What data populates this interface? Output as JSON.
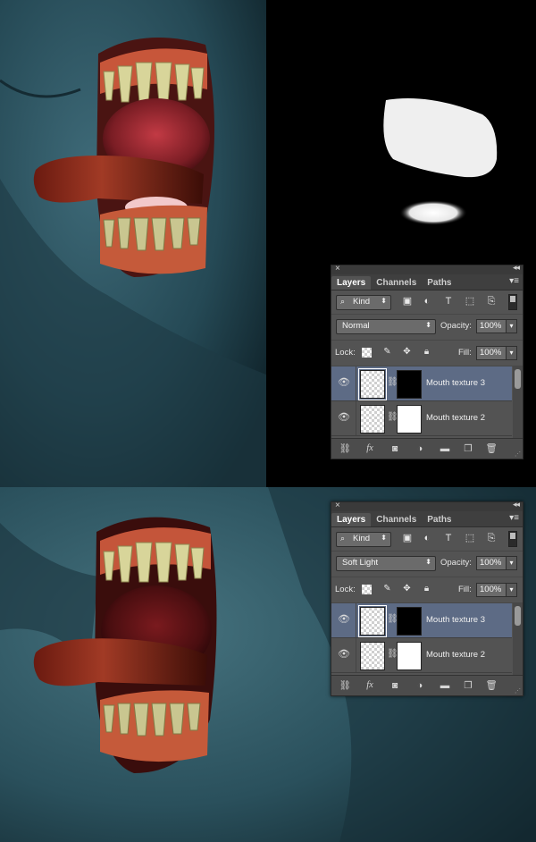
{
  "panels": [
    {
      "id": "top",
      "tabs": [
        "Layers",
        "Channels",
        "Paths"
      ],
      "kind_label": "Kind",
      "blend_mode": "Normal",
      "opacity_label": "Opacity:",
      "opacity_value": "100%",
      "lock_label": "Lock:",
      "fill_label": "Fill:",
      "fill_value": "100%",
      "layers": [
        {
          "name": "Mouth texture 3",
          "selected": true
        },
        {
          "name": "Mouth texture 2",
          "selected": false
        }
      ]
    },
    {
      "id": "bottom",
      "tabs": [
        "Layers",
        "Channels",
        "Paths"
      ],
      "kind_label": "Kind",
      "blend_mode": "Soft Light",
      "opacity_label": "Opacity:",
      "opacity_value": "100%",
      "lock_label": "Lock:",
      "fill_label": "Fill:",
      "fill_value": "100%",
      "layers": [
        {
          "name": "Mouth texture 3",
          "selected": true
        },
        {
          "name": "Mouth texture 2",
          "selected": false
        }
      ]
    }
  ],
  "icons": {
    "filter": [
      "image-filter-icon",
      "adjustment-filter-icon",
      "type-filter-icon",
      "shape-filter-icon",
      "smart-object-filter-icon"
    ],
    "lock": [
      "lock-transparent-icon",
      "lock-image-icon",
      "lock-position-icon",
      "lock-all-icon"
    ],
    "footer": [
      "link-layers-icon",
      "fx-icon",
      "add-mask-icon",
      "adjustment-layer-icon",
      "new-group-icon",
      "new-layer-icon",
      "trash-icon"
    ]
  },
  "fx_label": "fx",
  "colors": {
    "panel_bg": "#535353",
    "selected_layer": "#5d6b85",
    "skin": "#2d5461",
    "canvas_black": "#000000"
  }
}
